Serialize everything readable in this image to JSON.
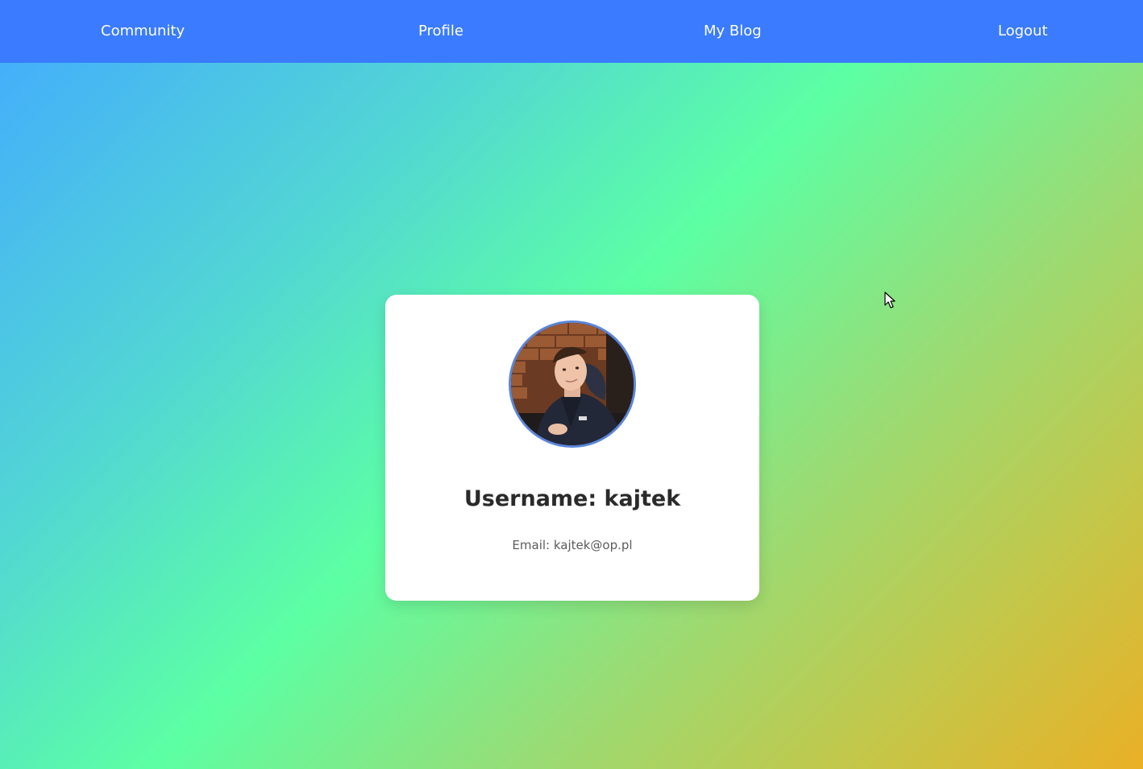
{
  "nav": {
    "items": [
      {
        "label": "Community"
      },
      {
        "label": "Profile"
      },
      {
        "label": "My Blog"
      },
      {
        "label": "Logout"
      }
    ],
    "background_color": "#3a7bff"
  },
  "profile_card": {
    "avatar_icon": "profile-photo",
    "username_text": "Username: kajtek",
    "email_text": "Email: kajtek@op.pl",
    "avatar_border_color": "#5a86dc"
  },
  "background": {
    "gradient_colors": [
      "#42aaff",
      "#5cffa4",
      "#eab026"
    ]
  }
}
